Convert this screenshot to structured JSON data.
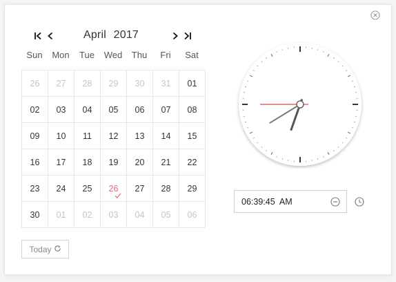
{
  "calendar": {
    "month": "April",
    "year": "2017",
    "weekdays": [
      "Sun",
      "Mon",
      "Tue",
      "Wed",
      "Thu",
      "Fri",
      "Sat"
    ],
    "days": [
      [
        "26",
        "27",
        "28",
        "29",
        "30",
        "31",
        "01"
      ],
      [
        "02",
        "03",
        "04",
        "05",
        "06",
        "07",
        "08"
      ],
      [
        "09",
        "10",
        "11",
        "12",
        "13",
        "14",
        "15"
      ],
      [
        "16",
        "17",
        "18",
        "19",
        "20",
        "21",
        "22"
      ],
      [
        "23",
        "24",
        "25",
        "26",
        "27",
        "28",
        "29"
      ],
      [
        "30",
        "01",
        "02",
        "03",
        "04",
        "05",
        "06"
      ]
    ],
    "muted": [
      [
        true,
        true,
        true,
        true,
        true,
        true,
        false
      ],
      [
        false,
        false,
        false,
        false,
        false,
        false,
        false
      ],
      [
        false,
        false,
        false,
        false,
        false,
        false,
        false
      ],
      [
        false,
        false,
        false,
        false,
        false,
        false,
        false
      ],
      [
        false,
        false,
        false,
        false,
        false,
        false,
        false
      ],
      [
        false,
        true,
        true,
        true,
        true,
        true,
        true
      ]
    ],
    "selected_day": "26",
    "today_label": "Today"
  },
  "time": {
    "value": "06:39:45  AM",
    "hours": 6,
    "minutes": 39,
    "seconds": 45
  },
  "icons": {
    "close": "close-circle-icon",
    "first": "first-page-icon",
    "prev": "chevron-left-icon",
    "next": "chevron-right-icon",
    "last": "last-page-icon",
    "refresh": "refresh-icon",
    "minus": "minus-circle-icon",
    "clock": "clock-icon"
  },
  "colors": {
    "accent": "#e06a74",
    "second_hand": "#e06a74",
    "hand": "#555555"
  }
}
